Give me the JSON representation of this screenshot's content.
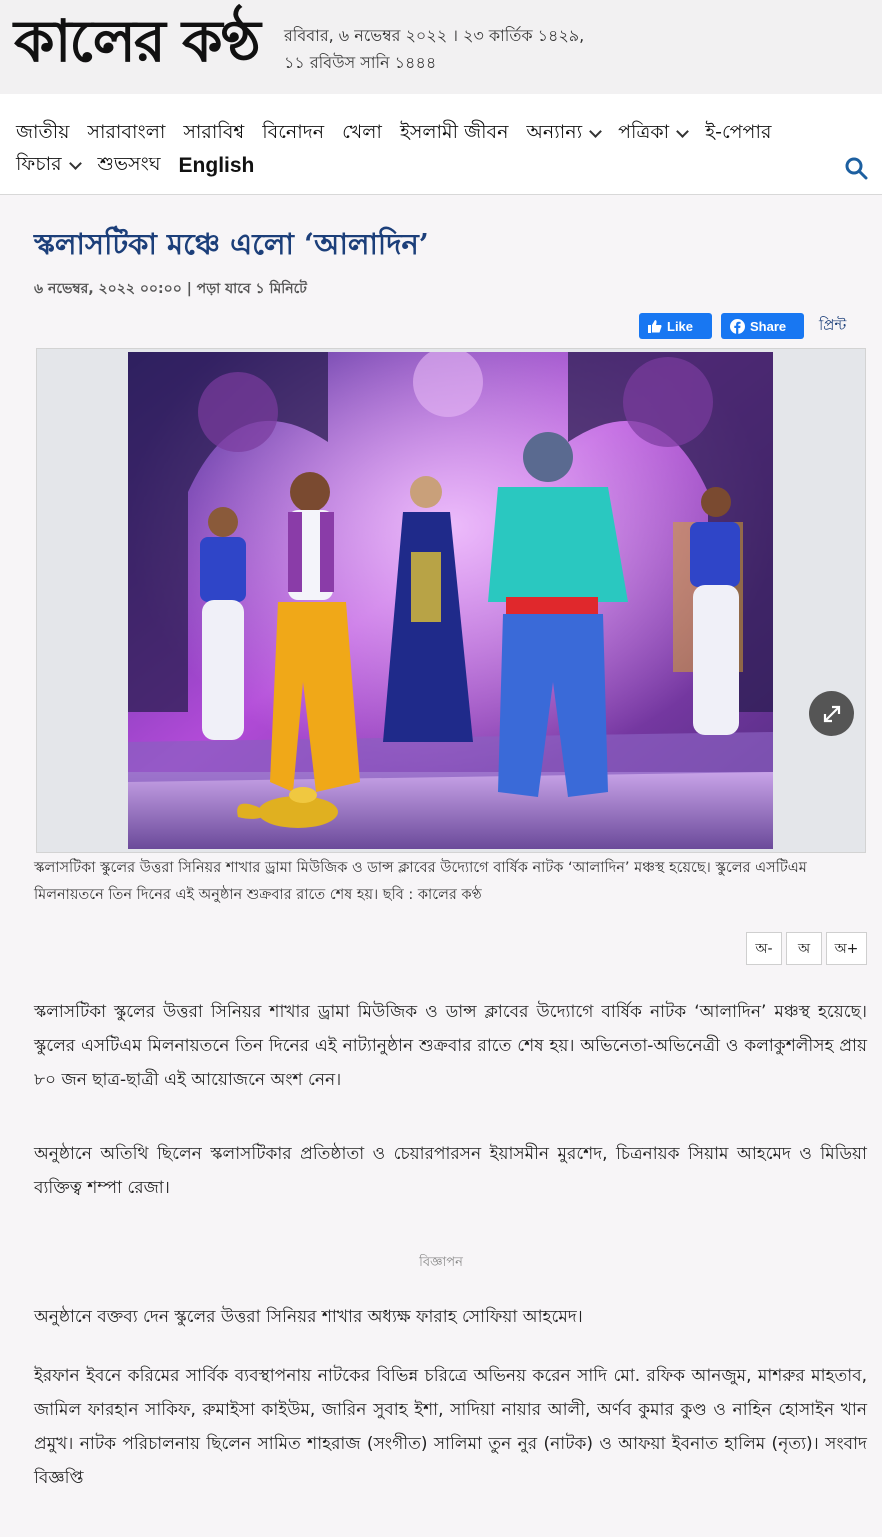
{
  "site": {
    "logo_text": "কালের কণ্ঠ",
    "date_line": "রবিবার, ৬ নভেম্বর ২০২২ । ২৩ কার্তিক ১৪২৯, ১১ রবিউস সানি ১৪৪৪"
  },
  "nav": {
    "row1": [
      {
        "label": "জাতীয়",
        "has_dropdown": false
      },
      {
        "label": "সারাবাংলা",
        "has_dropdown": false
      },
      {
        "label": "সারাবিশ্ব",
        "has_dropdown": false
      },
      {
        "label": "বিনোদন",
        "has_dropdown": false
      },
      {
        "label": "খেলা",
        "has_dropdown": false
      },
      {
        "label": "ইসলামী জীবন",
        "has_dropdown": false
      },
      {
        "label": "অন্যান্য",
        "has_dropdown": true
      },
      {
        "label": "পত্রিকা",
        "has_dropdown": true
      },
      {
        "label": "ই-পেপার",
        "has_dropdown": false
      }
    ],
    "row2": [
      {
        "label": "ফিচার",
        "has_dropdown": true
      },
      {
        "label": "শুভসংঘ",
        "has_dropdown": false
      }
    ],
    "english_label": "English",
    "search_icon": "search-icon"
  },
  "article": {
    "headline": "স্কলাসটিকা মঞ্চে এলো ‘আলাদিন’",
    "meta": "৬ নভেম্বর, ২০২২ ০০:০০ | পড়া যাবে ১ মিনিটে",
    "share": {
      "like_label": "Like",
      "share_label": "Share",
      "print_label": "প্রিন্ট"
    },
    "caption": "স্কলাসটিকা স্কুলের উত্তরা সিনিয়র শাখার ড্রামা মিউজিক ও ডান্স ক্লাবের উদ্যোগে বার্ষিক নাটক ‘আলাদিন’ মঞ্চস্থ হয়েছে। স্কুলের এসটিএম মিলনায়তনে তিন দিনের এই অনুষ্ঠান শুক্রবার রাতে শেষ হয়। ছবি : কালের কণ্ঠ",
    "font_size_buttons": {
      "decrease": "অ-",
      "reset": "অ",
      "increase": "অ+"
    },
    "paragraphs": [
      "স্কলাসটিকা স্কুলের উত্তরা সিনিয়র শাখার ড্রামা মিউজিক ও ডান্স ক্লাবের উদ্যোগে বার্ষিক নাটক ‘আলাদিন’ মঞ্চস্থ হয়েছে। স্কুলের এসটিএম মিলনায়তনে তিন দিনের এই নাট্যানুষ্ঠান শুক্রবার রাতে শেষ হয়। অভিনেতা-অভিনেত্রী ও কলাকুশলীসহ প্রায় ৮০ জন ছাত্র-ছাত্রী এই আয়োজনে অংশ নেন।",
      "অনুষ্ঠানে অতিথি ছিলেন স্কলাসটিকার প্রতিষ্ঠাতা ও চেয়ারপারসন ইয়াসমীন মুরশেদ, চিত্রনায়ক সিয়াম আহমেদ ও মিডিয়া ব্যক্তিত্ব শম্পা রেজা।",
      "অনুষ্ঠানে বক্তব্য দেন স্কুলের উত্তরা সিনিয়র শাখার অধ্যক্ষ ফারাহ সোফিয়া আহমেদ।",
      "ইরফান ইবনে করিমের সার্বিক ব্যবস্থাপনায় নাটকের বিভিন্ন চরিত্রে অভিনয় করেন সাদি মো. রফিক আনজুম, মাশরুর মাহতাব, জামিল ফারহান সাকিফ, রুমাইসা কাইউম, জারিন সুবাহ ইশা, সাদিয়া নায়ার আলী, অর্ণব কুমার কুণ্ড ও নাহিন হোসাইন খান প্রমুখ। নাটক পরিচালনায় ছিলেন সামিত শাহরাজ (সংগীত) সালিমা তুন নুর (নাটক) ও আফয়া ইবনাত হালিম (নৃত্য)। সংবাদ বিজ্ঞপ্তি"
    ],
    "ad_label": "বিজ্ঞাপন"
  },
  "colors": {
    "headline": "#1c3f7a",
    "facebook": "#1877f2",
    "page_bg": "#f7f5f7"
  }
}
